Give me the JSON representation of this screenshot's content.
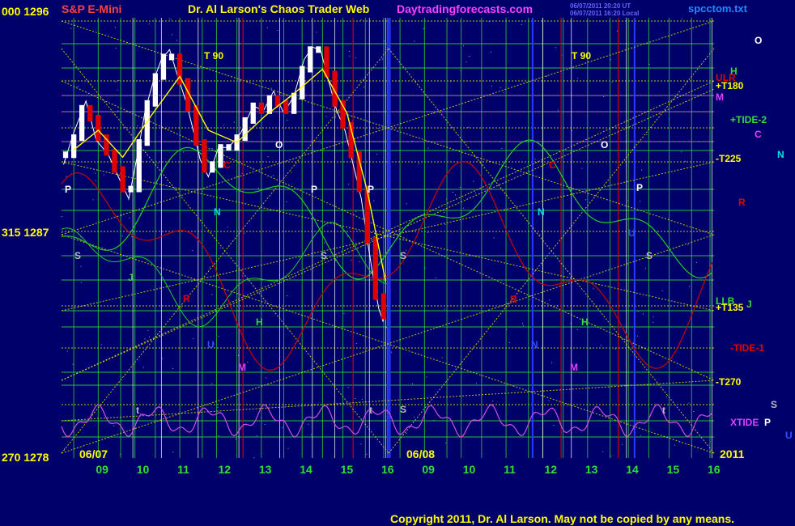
{
  "header": {
    "left_price": "000  1296",
    "symbol": "S&P E-Mini",
    "title": "Dr. Al Larson's Chaos Trader Web",
    "site": "Daytradingforecasts.com",
    "timestamp_line1": "06/07/2011 20:20 UT",
    "timestamp_line2": "06/07/2011 16:20 Local",
    "filename": "spcctom.txt"
  },
  "footer": {
    "copyright": "Copyright 2011, Dr. Al Larson. May not be copied by any means.",
    "year": "2011"
  },
  "colors": {
    "background": "#00006a",
    "grid_green": "#33dd33",
    "grid_yellow": "#e0e000",
    "price_up": "#ffffff",
    "price_down": "#e00000",
    "ema": "#ffff00",
    "tide": "#22cc22",
    "electric_field": "#cc0000",
    "xtide": "#d050e0"
  },
  "chart_data": {
    "type": "line",
    "title": "Dr. Al Larson's Chaos Trader Web",
    "xlabel": "",
    "ylabel": "",
    "ylim": [
      1278,
      1296
    ],
    "x_range_hours": [
      8,
      16
    ],
    "y_labels": [
      {
        "text": "315  1287",
        "value": 1287
      },
      {
        "text": "270  1278",
        "value": 1278
      }
    ],
    "date_labels": [
      "06/07",
      "06/08"
    ],
    "x_tick_labels": [
      "09",
      "10",
      "11",
      "12",
      "13",
      "14",
      "15",
      "16",
      "09",
      "10",
      "11",
      "12",
      "13",
      "14",
      "15",
      "16"
    ],
    "price_series": [
      {
        "hour": 8.05,
        "value": 1290.0
      },
      {
        "hour": 8.3,
        "value": 1291.3
      },
      {
        "hour": 8.6,
        "value": 1292.6
      },
      {
        "hour": 8.85,
        "value": 1291.0
      },
      {
        "hour": 9.15,
        "value": 1290.4
      },
      {
        "hour": 9.45,
        "value": 1289.3
      },
      {
        "hour": 9.65,
        "value": 1288.6
      },
      {
        "hour": 9.85,
        "value": 1290.3
      },
      {
        "hour": 10.05,
        "value": 1292.2
      },
      {
        "hour": 10.25,
        "value": 1293.4
      },
      {
        "hour": 10.45,
        "value": 1294.3
      },
      {
        "hour": 10.65,
        "value": 1294.7
      },
      {
        "hour": 10.85,
        "value": 1293.6
      },
      {
        "hour": 11.05,
        "value": 1292.6
      },
      {
        "hour": 11.2,
        "value": 1291.6
      },
      {
        "hour": 11.4,
        "value": 1290.2
      },
      {
        "hour": 11.6,
        "value": 1289.5
      },
      {
        "hour": 11.85,
        "value": 1290.7
      },
      {
        "hour": 12.1,
        "value": 1290.7
      },
      {
        "hour": 12.4,
        "value": 1291.3
      },
      {
        "hour": 12.7,
        "value": 1292.4
      },
      {
        "hour": 12.95,
        "value": 1292.2
      },
      {
        "hour": 13.2,
        "value": 1293.0
      },
      {
        "hour": 13.45,
        "value": 1292.1
      },
      {
        "hour": 13.7,
        "value": 1292.8
      },
      {
        "hour": 13.95,
        "value": 1294.3
      },
      {
        "hour": 14.15,
        "value": 1294.8
      },
      {
        "hour": 14.35,
        "value": 1294.7
      },
      {
        "hour": 14.55,
        "value": 1293.4
      },
      {
        "hour": 14.75,
        "value": 1292.2
      },
      {
        "hour": 14.95,
        "value": 1291.4
      },
      {
        "hour": 15.15,
        "value": 1290.0
      },
      {
        "hour": 15.35,
        "value": 1288.6
      },
      {
        "hour": 15.5,
        "value": 1286.9
      },
      {
        "hour": 15.65,
        "value": 1285.3
      },
      {
        "hour": 15.78,
        "value": 1284.1
      },
      {
        "hour": 15.88,
        "value": 1283.6
      },
      {
        "hour": 15.95,
        "value": 1284.0
      }
    ],
    "ema_series": [
      {
        "hour": 8.3,
        "value": 1290.6
      },
      {
        "hour": 8.9,
        "value": 1291.4
      },
      {
        "hour": 9.5,
        "value": 1290.3
      },
      {
        "hour": 10.2,
        "value": 1292.0
      },
      {
        "hour": 10.9,
        "value": 1293.6
      },
      {
        "hour": 11.6,
        "value": 1291.4
      },
      {
        "hour": 12.3,
        "value": 1290.9
      },
      {
        "hour": 13.0,
        "value": 1292.0
      },
      {
        "hour": 13.7,
        "value": 1292.9
      },
      {
        "hour": 14.4,
        "value": 1293.9
      },
      {
        "hour": 15.0,
        "value": 1292.1
      },
      {
        "hour": 15.5,
        "value": 1288.9
      },
      {
        "hour": 15.95,
        "value": 1285.2
      }
    ],
    "price_bars": [
      {
        "hour": 8.1,
        "value": 1290.4
      },
      {
        "hour": 8.3,
        "value": 1291.1
      },
      {
        "hour": 8.5,
        "value": 1292.3
      },
      {
        "hour": 8.7,
        "value": 1291.9
      },
      {
        "hour": 8.9,
        "value": 1291.1
      },
      {
        "hour": 9.1,
        "value": 1290.5
      },
      {
        "hour": 9.3,
        "value": 1289.8
      },
      {
        "hour": 9.5,
        "value": 1289.0
      },
      {
        "hour": 9.7,
        "value": 1289.0
      },
      {
        "hour": 9.9,
        "value": 1290.9
      },
      {
        "hour": 10.1,
        "value": 1292.5
      },
      {
        "hour": 10.3,
        "value": 1293.6
      },
      {
        "hour": 10.5,
        "value": 1294.4
      },
      {
        "hour": 10.7,
        "value": 1294.4
      },
      {
        "hour": 10.9,
        "value": 1293.4
      },
      {
        "hour": 11.1,
        "value": 1292.3
      },
      {
        "hour": 11.3,
        "value": 1290.9
      },
      {
        "hour": 11.5,
        "value": 1289.8
      },
      {
        "hour": 11.7,
        "value": 1290.0
      },
      {
        "hour": 11.9,
        "value": 1290.7
      },
      {
        "hour": 12.1,
        "value": 1290.7
      },
      {
        "hour": 12.3,
        "value": 1291.1
      },
      {
        "hour": 12.5,
        "value": 1291.8
      },
      {
        "hour": 12.7,
        "value": 1292.4
      },
      {
        "hour": 12.9,
        "value": 1292.2
      },
      {
        "hour": 13.1,
        "value": 1292.7
      },
      {
        "hour": 13.3,
        "value": 1292.5
      },
      {
        "hour": 13.5,
        "value": 1292.2
      },
      {
        "hour": 13.7,
        "value": 1292.8
      },
      {
        "hour": 13.9,
        "value": 1293.9
      },
      {
        "hour": 14.1,
        "value": 1294.7
      },
      {
        "hour": 14.3,
        "value": 1294.7
      },
      {
        "hour": 14.5,
        "value": 1293.7
      },
      {
        "hour": 14.7,
        "value": 1292.5
      },
      {
        "hour": 14.9,
        "value": 1291.6
      },
      {
        "hour": 15.1,
        "value": 1290.4
      },
      {
        "hour": 15.3,
        "value": 1289.0
      },
      {
        "hour": 15.5,
        "value": 1286.9
      },
      {
        "hour": 15.7,
        "value": 1284.6
      },
      {
        "hour": 15.9,
        "value": 1283.8
      }
    ],
    "annotations": {
      "time_labels": [
        "T  90",
        "T  90"
      ],
      "planet_letters": [
        "P",
        "N",
        "S",
        "J",
        "R",
        "H",
        "M",
        "C",
        "O",
        "S",
        "P",
        "P",
        "S",
        "t",
        "t",
        "U",
        "C",
        "O",
        "N",
        "P",
        "S",
        "R",
        "H",
        "M",
        "N",
        "U",
        "S",
        "t"
      ],
      "right_labels": [
        {
          "text": "O",
          "color": "#ffffff"
        },
        {
          "text": "H",
          "color": "#33dd33"
        },
        {
          "text": "ULR",
          "color": "#e00000"
        },
        {
          "text": "+T180",
          "color": "#ffff00"
        },
        {
          "text": "M",
          "color": "#e040ff"
        },
        {
          "text": "+TIDE-2",
          "color": "#33dd33"
        },
        {
          "text": "C",
          "color": "#e040ff"
        },
        {
          "text": "N",
          "color": "#00e0e0"
        },
        {
          "text": "-T225",
          "color": "#ffff00"
        },
        {
          "text": "R",
          "color": "#e00000"
        },
        {
          "text": "LLB",
          "color": "#33dd33"
        },
        {
          "text": "+T135",
          "color": "#ffff00"
        },
        {
          "text": "J",
          "color": "#33dd33"
        },
        {
          "text": "-TIDE-1",
          "color": "#e00000"
        },
        {
          "text": "-T270",
          "color": "#ffff00"
        },
        {
          "text": "S",
          "color": "#bbbbbb"
        },
        {
          "text": "XTIDE",
          "color": "#e040ff"
        },
        {
          "text": "P",
          "color": "#ffffff"
        },
        {
          "text": "U",
          "color": "#3050ff"
        }
      ]
    },
    "grid": true
  }
}
